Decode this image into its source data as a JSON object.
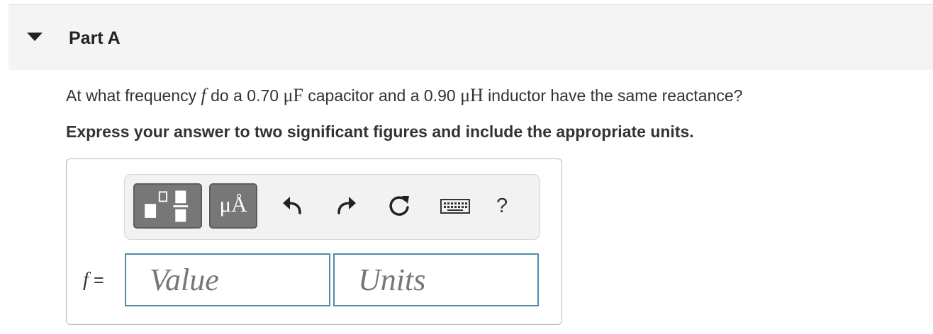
{
  "part": {
    "title": "Part A"
  },
  "question": {
    "text_before": "At what frequency ",
    "variable": "f",
    "text_mid1": " do a 0.70 ",
    "capacitance_unit": "μF",
    "text_mid2": " capacitor and a 0.90 ",
    "inductance_unit": "μH",
    "text_after": " inductor have the same reactance?"
  },
  "instruction": "Express your answer to two significant figures and include the appropriate units.",
  "toolbar": {
    "units_button_label": "μÅ",
    "help_label": "?",
    "icons": [
      "templates-icon",
      "units-icon",
      "undo-icon",
      "redo-icon",
      "reset-icon",
      "keyboard-icon",
      "help-icon"
    ]
  },
  "answer": {
    "variable": "f",
    "equals": " =",
    "value_placeholder": "Value",
    "units_placeholder": "Units"
  },
  "colors": {
    "header_bg": "#f4f4f4",
    "field_border": "#4f8cab",
    "dark_button": "#777777"
  }
}
